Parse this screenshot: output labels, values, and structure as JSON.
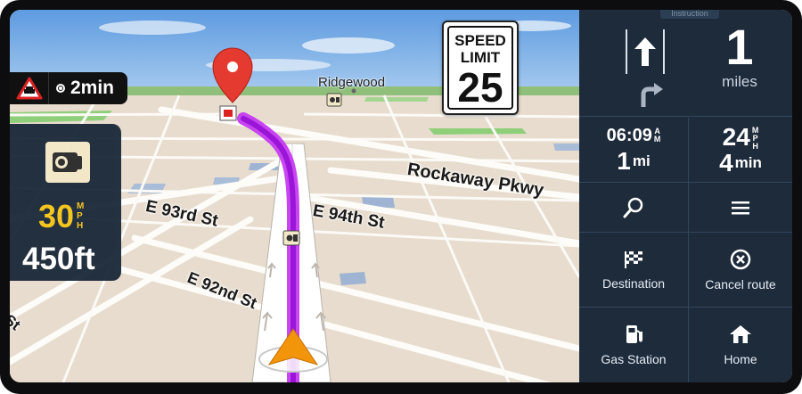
{
  "map": {
    "place_label": "Ridgewood",
    "streets": {
      "rockaway": "Rockaway Pkwy",
      "e93": "E 93rd St",
      "e94": "E 94th St",
      "e92": "E 92nd St",
      "edge": "St"
    },
    "alert": {
      "eta": "2min"
    },
    "camera": {
      "speed": "30",
      "unit_top": "M",
      "unit_bottom_1": "P",
      "unit_bottom_2": "H",
      "distance": "450ft"
    },
    "speed_limit": {
      "line1": "SPEED",
      "line2": "LIMIT",
      "value": "25"
    },
    "colors": {
      "route": "#a020e0",
      "route_trail": "#c53bf0",
      "land": "#e7dccd",
      "sky": "#7fb3e6",
      "park": "#8fcf7a",
      "cursor": "#f2950a"
    }
  },
  "panel": {
    "instruction_tag": "Instruction",
    "distance_value": "1",
    "distance_unit": "miles",
    "arrival": {
      "time": "06:09",
      "time_suffix_1": "A",
      "time_suffix_2": "M",
      "distance": "1",
      "distance_unit": "mi"
    },
    "speed": {
      "value": "24",
      "unit_1": "M",
      "unit_2": "P",
      "unit_3": "H",
      "time": "4",
      "time_unit": "min"
    },
    "buttons": {
      "destination": "Destination",
      "cancel_route": "Cancel route",
      "gas_station": "Gas Station",
      "home": "Home"
    },
    "colors": {
      "background": "#1e2b3b",
      "divider": "#32465c",
      "text": "#ffffff"
    }
  }
}
